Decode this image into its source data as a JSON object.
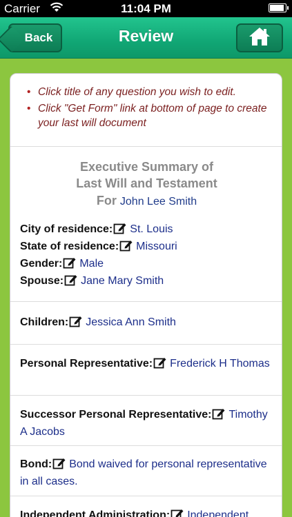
{
  "status_bar": {
    "carrier": "Carrier",
    "time": "11:04 PM"
  },
  "navbar": {
    "back_label": "Back",
    "title": "Review",
    "home_icon": "home-icon",
    "accent_color": "#11a775"
  },
  "instructions": [
    "Click title of any question you wish to edit.",
    "Click \"Get Form\" link at bottom of page to create your last will document"
  ],
  "summary": {
    "title_line1": "Executive Summary of",
    "title_line2": "Last Will and Testament",
    "for_label": "For",
    "for_name": "John Lee Smith"
  },
  "fields": {
    "city": {
      "label": "City of residence:",
      "value": "St. Louis"
    },
    "state": {
      "label": "State of residence:",
      "value": "Missouri"
    },
    "gender": {
      "label": "Gender:",
      "value": "Male"
    },
    "spouse": {
      "label": "Spouse:",
      "value": "Jane Mary Smith"
    },
    "children": {
      "label": "Children:",
      "value": "Jessica Ann Smith"
    },
    "personal_rep": {
      "label": "Personal Representative:",
      "value": "Frederick H Thomas"
    },
    "successor_rep": {
      "label": "Successor Personal Representative:",
      "value": "Timothy A Jacobs"
    },
    "bond": {
      "label": "Bond:",
      "value": "Bond waived for personal representative in all cases."
    },
    "independent": {
      "label": "Independent Administration:",
      "value": "Independent"
    }
  },
  "colors": {
    "page_background": "#8cc63f",
    "instruction_text": "#7a1e1e",
    "value_text": "#1c2e8a",
    "summary_title": "#8a8a8a"
  }
}
